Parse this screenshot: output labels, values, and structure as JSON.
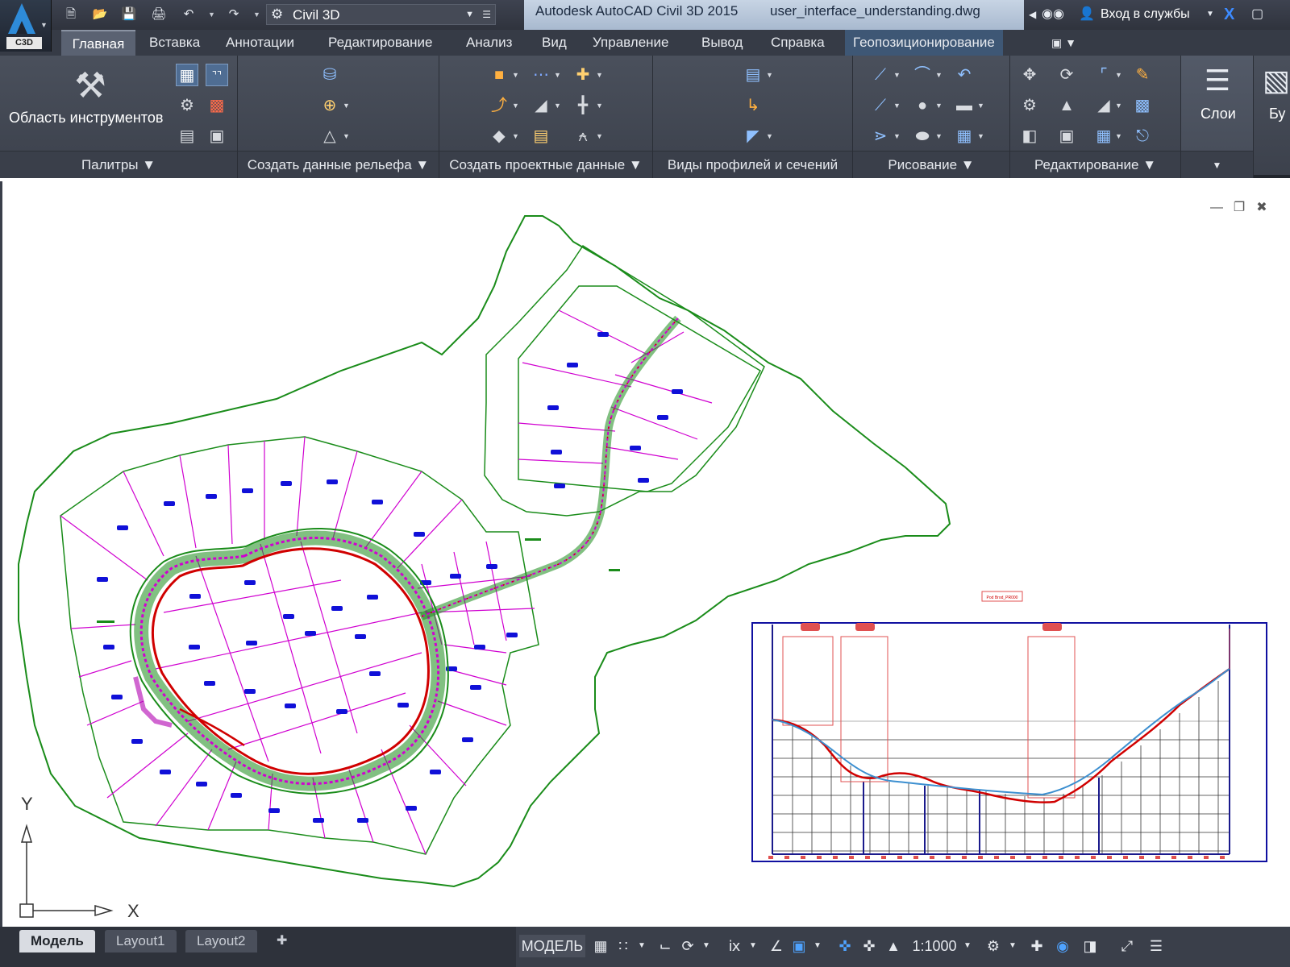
{
  "titlebar": {
    "app_button_label": "C3D",
    "workspace_name": "Civil 3D",
    "app_name": "Autodesk AutoCAD Civil 3D 2015",
    "file_name": "user_interface_understanding.dwg",
    "signin_label": "Вход в службы"
  },
  "tabs": [
    {
      "label": "Главная",
      "active": true
    },
    {
      "label": "Вставка"
    },
    {
      "label": "Аннотации"
    },
    {
      "label": "Редактирование"
    },
    {
      "label": "Анализ"
    },
    {
      "label": "Вид"
    },
    {
      "label": "Управление"
    },
    {
      "label": "Вывод"
    },
    {
      "label": "Справка"
    },
    {
      "label": "Геопозиционирование"
    }
  ],
  "ribbon": {
    "palettes": {
      "big_button_label": "Область инструментов",
      "title": "Палитры"
    },
    "surface": {
      "title": "Создать данные рельефа"
    },
    "design": {
      "title": "Создать проектные данные"
    },
    "profiles": {
      "title": "Виды профилей и сечений"
    },
    "draw": {
      "title": "Рисование"
    },
    "modify": {
      "title": "Редактирование"
    },
    "layers": {
      "big_button_label": "Слои",
      "title": ""
    },
    "clip": {
      "big_button_label": "Бу"
    }
  },
  "drawing": {
    "profile_title": "Pod Brod_PR000",
    "ucs_x": "X",
    "ucs_y": "Y"
  },
  "layout_tabs": [
    {
      "label": "Модель",
      "active": true
    },
    {
      "label": "Layout1"
    },
    {
      "label": "Layout2"
    }
  ],
  "status": {
    "space": "МОДЕЛЬ",
    "scale": "1:1000"
  },
  "colors": {
    "boundary": "#1a8c1a",
    "parcel_lines": "#d000d0",
    "buildings": "#1010d8",
    "road_edge": "#d00000",
    "profile_grid": "#1a1a8c",
    "profile_existing": "#d00000",
    "profile_design": "#3c8fd0"
  }
}
